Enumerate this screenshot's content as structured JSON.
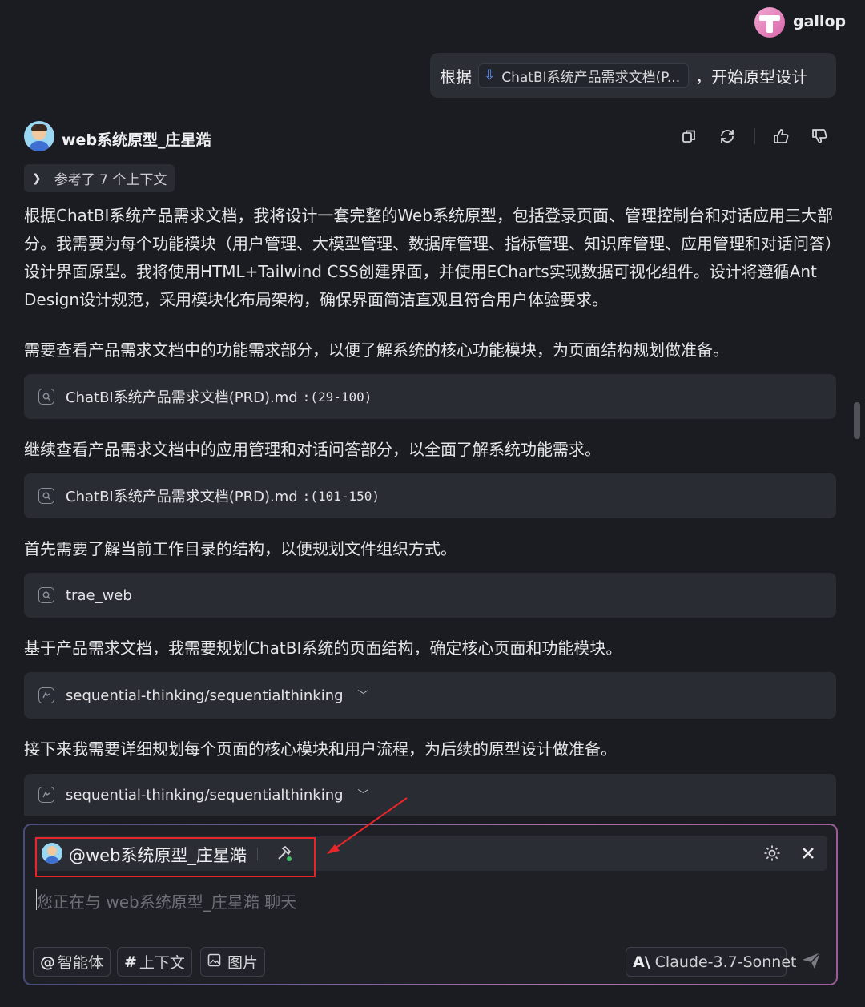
{
  "user": {
    "name": "gallop",
    "avatar_icon": "user-avatar-icon"
  },
  "user_message": {
    "prefix": "根据",
    "file_chip": "ChatBI系统产品需求文档(P...",
    "suffix": "，开始原型设计"
  },
  "assistant": {
    "name": "web系统原型_庄星澔",
    "actions": [
      "copy-icon",
      "regenerate-icon",
      "thumbs-up-icon",
      "thumbs-down-icon"
    ],
    "context_ref": "参考了 7 个上下文",
    "intro": "根据ChatBI系统产品需求文档，我将设计一套完整的Web系统原型，包括登录页面、管理控制台和对话应用三大部分。我需要为每个功能模块（用户管理、大模型管理、数据库管理、指标管理、知识库管理、应用管理和对话问答）设计界面原型。我将使用HTML+Tailwind CSS创建界面，并使用ECharts实现数据可视化组件。设计将遵循Ant Design设计规范，采用模块化布局架构，确保界面简洁直观且符合用户体验要求。",
    "steps": [
      {
        "text": "需要查看产品需求文档中的功能需求部分，以便了解系统的核心功能模块，为页面结构规划做准备。",
        "tool_name": "ChatBI系统产品需求文档(PRD).md",
        "tool_range": ":(29-100)",
        "tool_icon": "search-icon"
      },
      {
        "text": "继续查看产品需求文档中的应用管理和对话问答部分，以全面了解系统功能需求。",
        "tool_name": "ChatBI系统产品需求文档(PRD).md",
        "tool_range": ":(101-150)",
        "tool_icon": "search-icon"
      },
      {
        "text": "首先需要了解当前工作目录的结构，以便规划文件组织方式。",
        "tool_name": "trae_web",
        "tool_range": "",
        "tool_icon": "search-icon"
      },
      {
        "text": "基于产品需求文档，我需要规划ChatBI系统的页面结构，确定核心页面和功能模块。",
        "tool_name": "sequential-thinking/sequentialthinking",
        "tool_range": "",
        "tool_icon": "mcp-tool-icon"
      },
      {
        "text": "接下来我需要详细规划每个页面的核心模块和用户流程，为后续的原型设计做准备。",
        "tool_name": "sequential-thinking/sequentialthinking",
        "tool_range": "",
        "tool_icon": "mcp-tool-icon"
      }
    ]
  },
  "chat_input": {
    "agent_name": "@web系统原型_庄星澔",
    "placeholder": "您正在与 web系统原型_庄星澔 聊天",
    "buttons": [
      {
        "symbol": "@",
        "label": "智能体"
      },
      {
        "symbol": "#",
        "label": "上下文"
      },
      {
        "symbol": "",
        "label": "图片"
      }
    ],
    "model": "Claude-3.7-Sonnet",
    "accent_border": "#e8262a"
  }
}
